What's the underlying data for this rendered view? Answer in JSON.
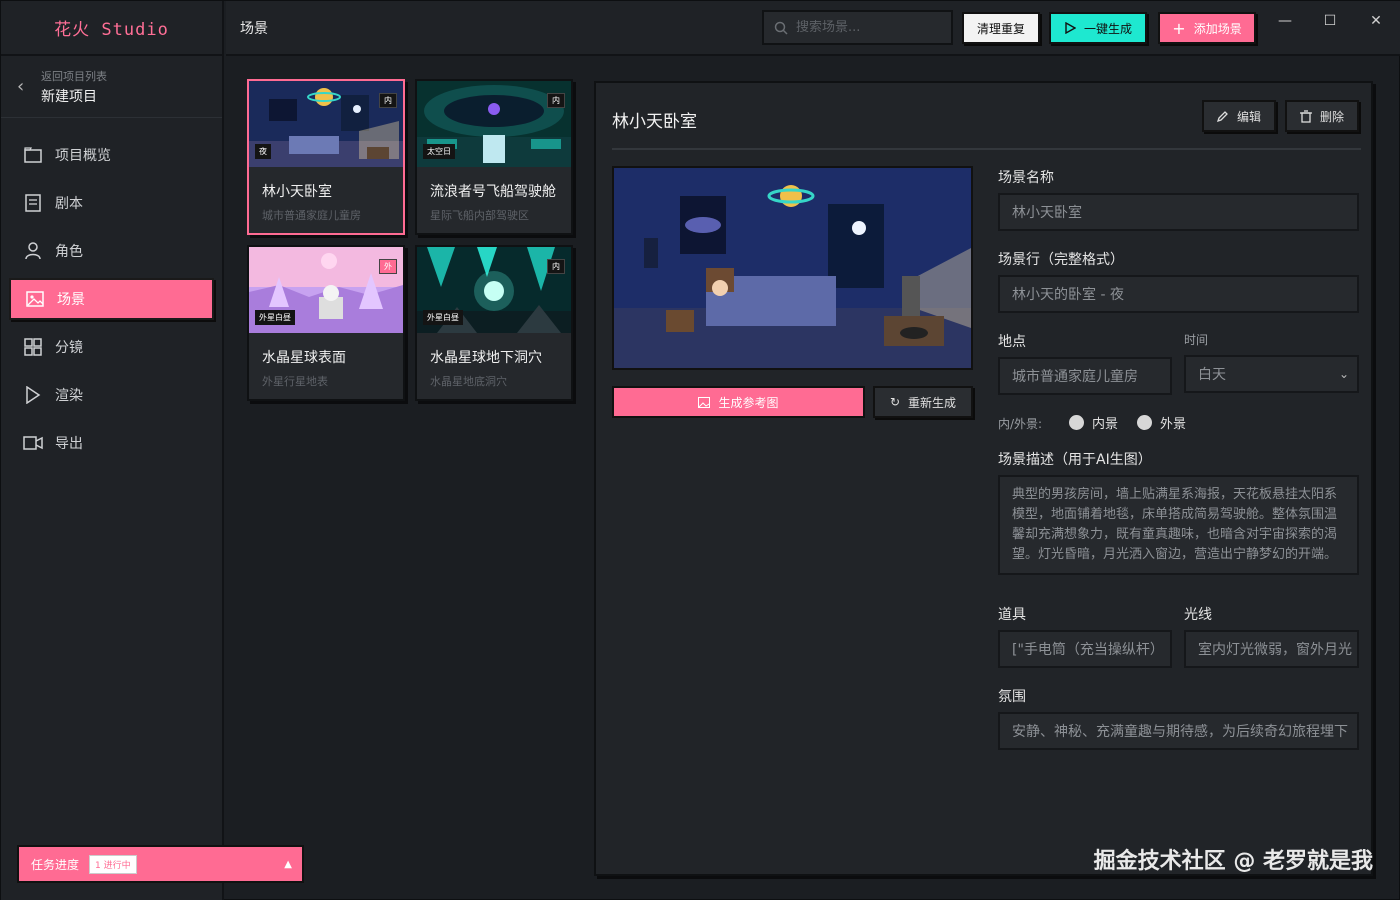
{
  "app": {
    "brand": "花火 Studio"
  },
  "back": {
    "small": "返回项目列表",
    "big": "新建项目"
  },
  "nav": {
    "items": [
      {
        "label": "项目概览",
        "icon": "folder-icon"
      },
      {
        "label": "剧本",
        "icon": "script-icon"
      },
      {
        "label": "角色",
        "icon": "user-icon"
      },
      {
        "label": "场景",
        "icon": "image-icon",
        "active": true
      },
      {
        "label": "分镜",
        "icon": "grid-icon"
      },
      {
        "label": "渲染",
        "icon": "play-icon"
      },
      {
        "label": "导出",
        "icon": "video-icon"
      }
    ]
  },
  "header": {
    "title": "场景",
    "search_placeholder": "搜索场景...",
    "clean_label": "清理重复",
    "generate_label": "一键生成",
    "add_label": "添加场景"
  },
  "window": {
    "minimize": "—",
    "maximize": "☐",
    "close": "✕"
  },
  "scenes": [
    {
      "name": "林小天卧室",
      "location": "城市普通家庭儿童房",
      "tag_right": "内",
      "tag_left": "夜",
      "selected": true
    },
    {
      "name": "流浪者号飞船驾驶舱",
      "location": "星际飞船内部驾驶区",
      "tag_right": "内",
      "tag_left": "太空日"
    },
    {
      "name": "水晶星球表面",
      "location": "外星行星地表",
      "tag_right": "外",
      "tag_left": "外星白昼"
    },
    {
      "name": "水晶星球地下洞穴",
      "location": "水晶星地底洞穴",
      "tag_right": "内",
      "tag_left": "外星白昼"
    }
  ],
  "detail": {
    "title": "林小天卧室",
    "edit_label": "编辑",
    "delete_label": "删除",
    "generate_ref_label": "生成参考图",
    "regenerate_label": "重新生成",
    "name_label": "场景名称",
    "name_value": "林小天卧室",
    "heading_label": "场景行（完整格式）",
    "heading_value": "林小天的卧室 - 夜",
    "location_label": "地点",
    "location_value": "城市普通家庭儿童房",
    "time_label": "时间",
    "time_value": "白天",
    "inout_label": "内/外景:",
    "interior_label": "内景",
    "exterior_label": "外景",
    "desc_label": "场景描述（用于AI生图）",
    "desc_value": "典型的男孩房间，墙上贴满星系海报，天花板悬挂太阳系模型，地面铺着地毯，床单搭成简易驾驶舱。整体氛围温馨却充满想象力，既有童真趣味，也暗含对宇宙探索的渴望。灯光昏暗，月光洒入窗边，营造出宁静梦幻的开端。",
    "props_label": "道具",
    "props_value": "[\"手电筒（充当操纵杆）",
    "light_label": "光线",
    "light_value": "室内灯光微弱，窗外月光",
    "mood_label": "氛围",
    "mood_value": "安静、神秘、充满童趣与期待感，为后续奇幻旅程埋下"
  },
  "task": {
    "label": "任务进度",
    "badge": "1 进行中",
    "arrow": "▲"
  },
  "watermark": "掘金技术社区 @ 老罗就是我",
  "colors": {
    "accent": "#ff6b93",
    "teal": "#1ee8d0",
    "bg": "#1b1e22"
  }
}
